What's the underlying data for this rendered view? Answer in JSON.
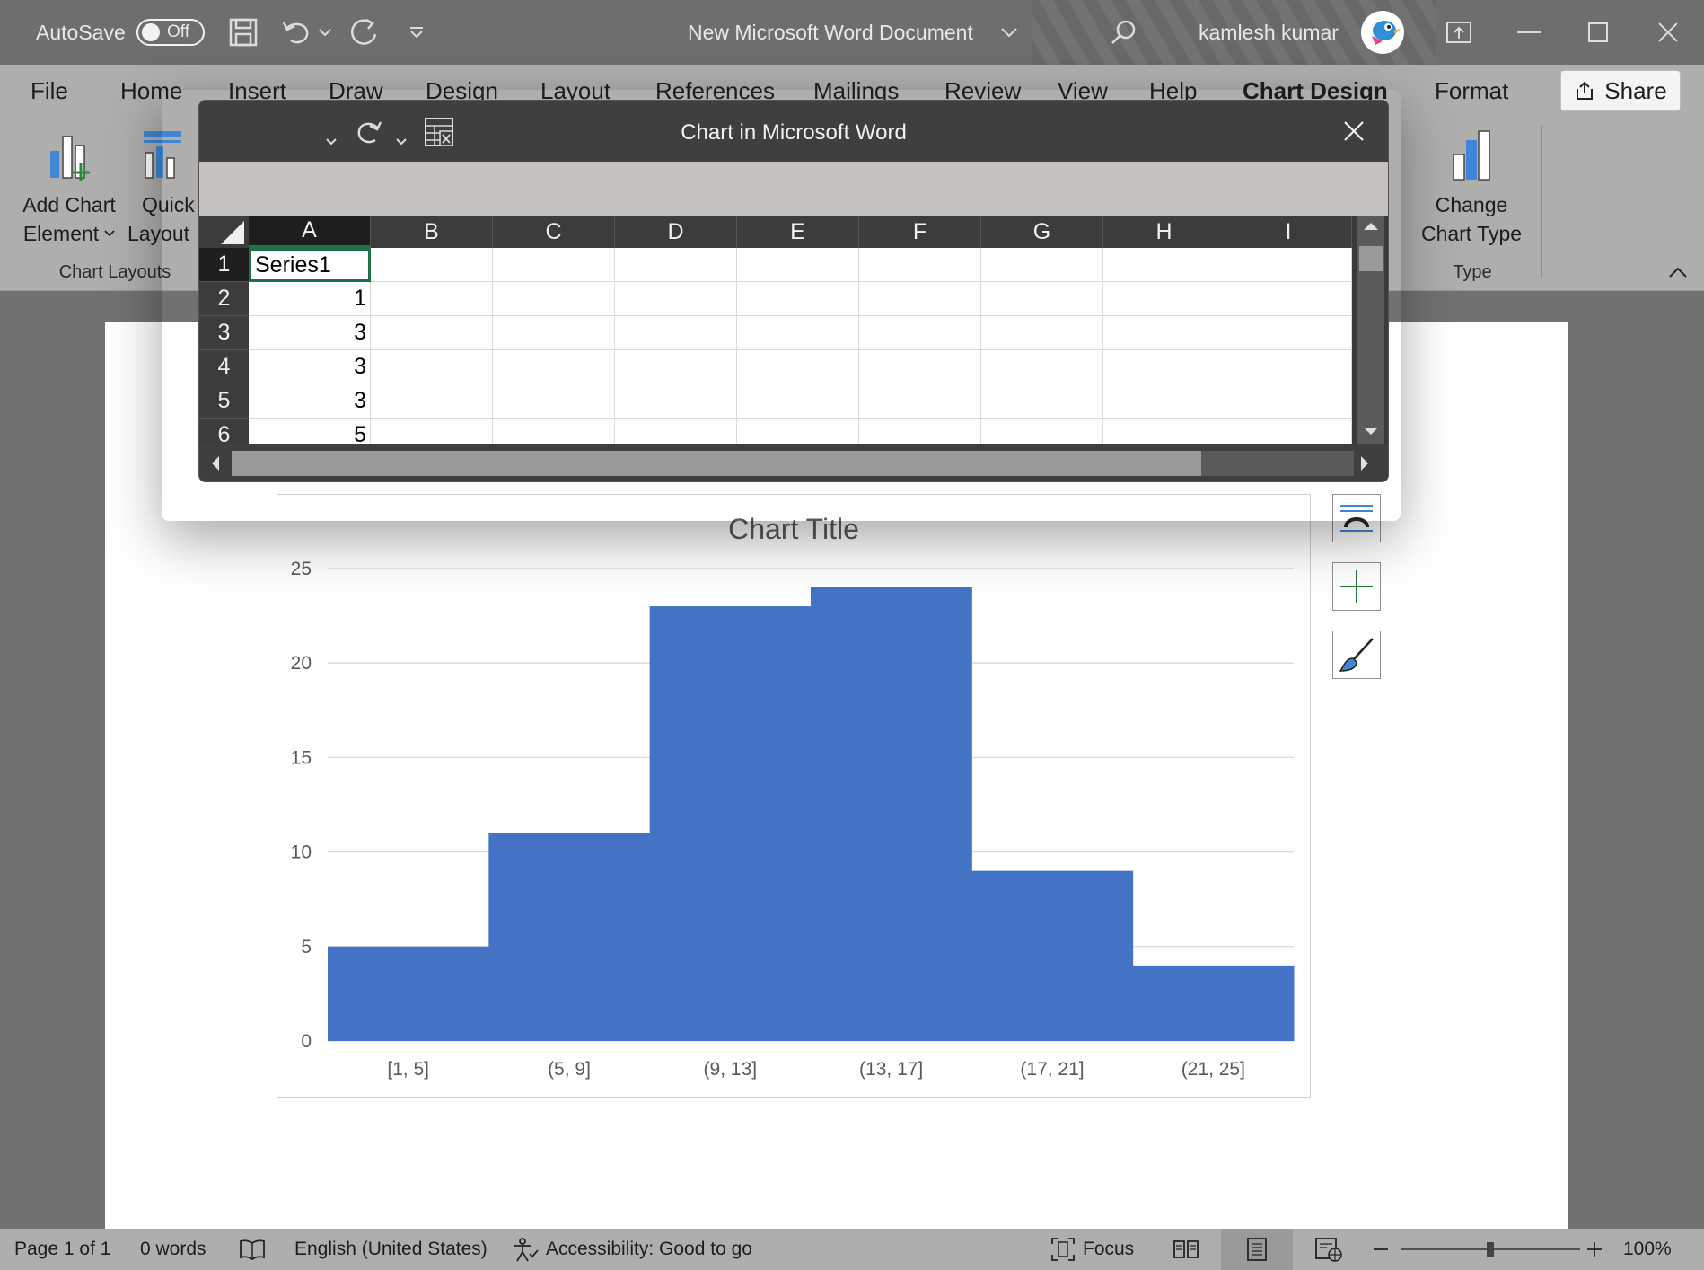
{
  "titlebar": {
    "autosave_label": "AutoSave",
    "autosave_state": "Off",
    "document_title": "New Microsoft Word Document",
    "user_name": "kamlesh kumar"
  },
  "menu": {
    "tabs": [
      "File",
      "Home",
      "Insert",
      "Draw",
      "Design",
      "Layout",
      "References",
      "Mailings",
      "Review",
      "View",
      "Help",
      "Chart Design",
      "Format"
    ],
    "active_tab": "Chart Design",
    "share_label": "Share"
  },
  "ribbon": {
    "add_chart_element_line1": "Add Chart",
    "add_chart_element_line2": "Element",
    "quick_layout_line1": "Quick",
    "quick_layout_line2": "Layout",
    "chart_layouts_group": "Chart Layouts",
    "change_chart_type_line1": "Change",
    "change_chart_type_line2": "Chart Type",
    "type_group": "Type"
  },
  "spreadsheet": {
    "title": "Chart in Microsoft Word",
    "columns": [
      "A",
      "B",
      "C",
      "D",
      "E",
      "F",
      "G",
      "H",
      "I"
    ],
    "rows": [
      "1",
      "2",
      "3",
      "4",
      "5",
      "6"
    ],
    "column_a": [
      "Series1",
      "1",
      "3",
      "3",
      "3",
      "5"
    ]
  },
  "chart_data": {
    "type": "bar",
    "title": "Chart Title",
    "categories": [
      "[1, 5]",
      "(5, 9]",
      "(9, 13]",
      "(13, 17]",
      "(17, 21]",
      "(21, 25]"
    ],
    "values": [
      5,
      11,
      23,
      24,
      9,
      4
    ],
    "ylim": [
      0,
      25
    ],
    "yticks": [
      "0",
      "5",
      "10",
      "15",
      "20",
      "25"
    ],
    "grid": true,
    "bar_color": "#4472C4"
  },
  "statusbar": {
    "page": "Page 1 of 1",
    "words": "0 words",
    "language": "English (United States)",
    "accessibility": "Accessibility: Good to go",
    "focus": "Focus",
    "zoom": "100%"
  }
}
